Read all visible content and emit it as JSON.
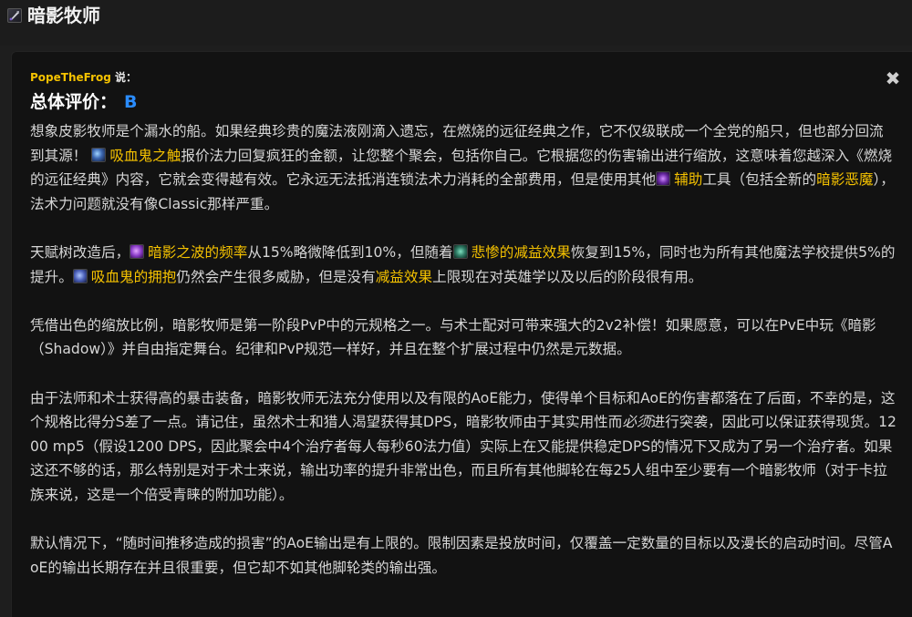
{
  "header": {
    "title": "暗影牧师"
  },
  "review": {
    "author": "PopeTheFrog",
    "author_says": "说：",
    "rating_label": "总体评价：",
    "rating_grade": "B",
    "close_symbol": "✖"
  },
  "paragraphs": {
    "p1_a": "想象皮影牧师是个漏水的船。如果经典珍贵的魔法液刚滴入遗忘，在燃烧的远征经典之作，它不仅级联成一个全党的船只，但也部分回流到其源！",
    "p1_link1": "吸血鬼之触",
    "p1_b": "报价法力回复疯狂的金额，让您整个聚会，包括你自己。它根据您的伤害输出进行缩放，这意味着您越深入《燃烧的远征经典》内容，它就会变得越有效。它永远无法抵消连锁法术力消耗的全部费用，但是使用其他",
    "p1_link2": "辅助",
    "p1_c": "工具（包括全新的",
    "p1_link3": "暗影恶魔",
    "p1_d": "），法术力问题就没有像Classic那样严重。",
    "p2_a": "天赋树改造后，",
    "p2_link1": "暗影之波的频率",
    "p2_b": "从15%略微降低到10%，但随着",
    "p2_link2": "悲惨的减益效果",
    "p2_c": "恢复到15%，同时也为所有其他魔法学校提供5%的提升。",
    "p2_link3": "吸血鬼的拥抱",
    "p2_d": "仍然会产生很多威胁，但是没有",
    "p2_link4": "减益效果",
    "p2_e": "上限现在对英雄学以及以后的阶段很有用。",
    "p3": "凭借出色的缩放比例，暗影牧师是第一阶段PvP中的元规格之一。与术士配对可带来强大的2v2补偿！如果愿意，可以在PvE中玩《暗影（Shadow）》并自由指定舞台。纪律和PvP规范一样好，并且在整个扩展过程中仍然是元数据。",
    "p4_a": "由于法师和术士获得高的暴击装备，暗影牧师无法充分使用以及有限的AoE能力，使得单个目标和AoE的伤害都落在了后面，不幸的是，这个规格比得分S差了一点。请记住，虽然术士和猎人渴望获得其DPS，暗影牧师由于其实用性而",
    "p4_ital": "必须",
    "p4_b": "进行突袭，因此可以保证获得现货。1200 mp5（假设1200 DPS，因此聚会中4个治疗者每人每秒60法力值）实际上在又能提供稳定DPS的情况下又成为了另一个治疗者。如果这还不够的话，那么特别是对于术士来说，输出功率的提升非常出色，而且所有其他脚轮在每25人组中至少要有一个暗影牧师（对于卡拉族来说，这是一个倍受青睐的附加功能）。",
    "p5": "默认情况下，“随时间推移造成的损害”的AoE输出是有上限的。限制因素是投放时间，仅覆盖一定数量的目标以及漫长的启动时间。尽管AoE的输出长期存在并且很重要，但它却不如其他脚轮类的输出强。"
  },
  "icons": {
    "header": "shadow-priest-class-icon",
    "p1_link1": "vampiric-touch-icon",
    "p1_link2": "helper-spell-icon",
    "p2_link1": "shadow-weaving-icon",
    "p2_link2": "misery-icon",
    "p2_link3": "vampiric-embrace-icon"
  },
  "colors": {
    "link": "#f5c200",
    "author": "#f5c200",
    "grade": "#2a8cff",
    "background": "#121212"
  }
}
